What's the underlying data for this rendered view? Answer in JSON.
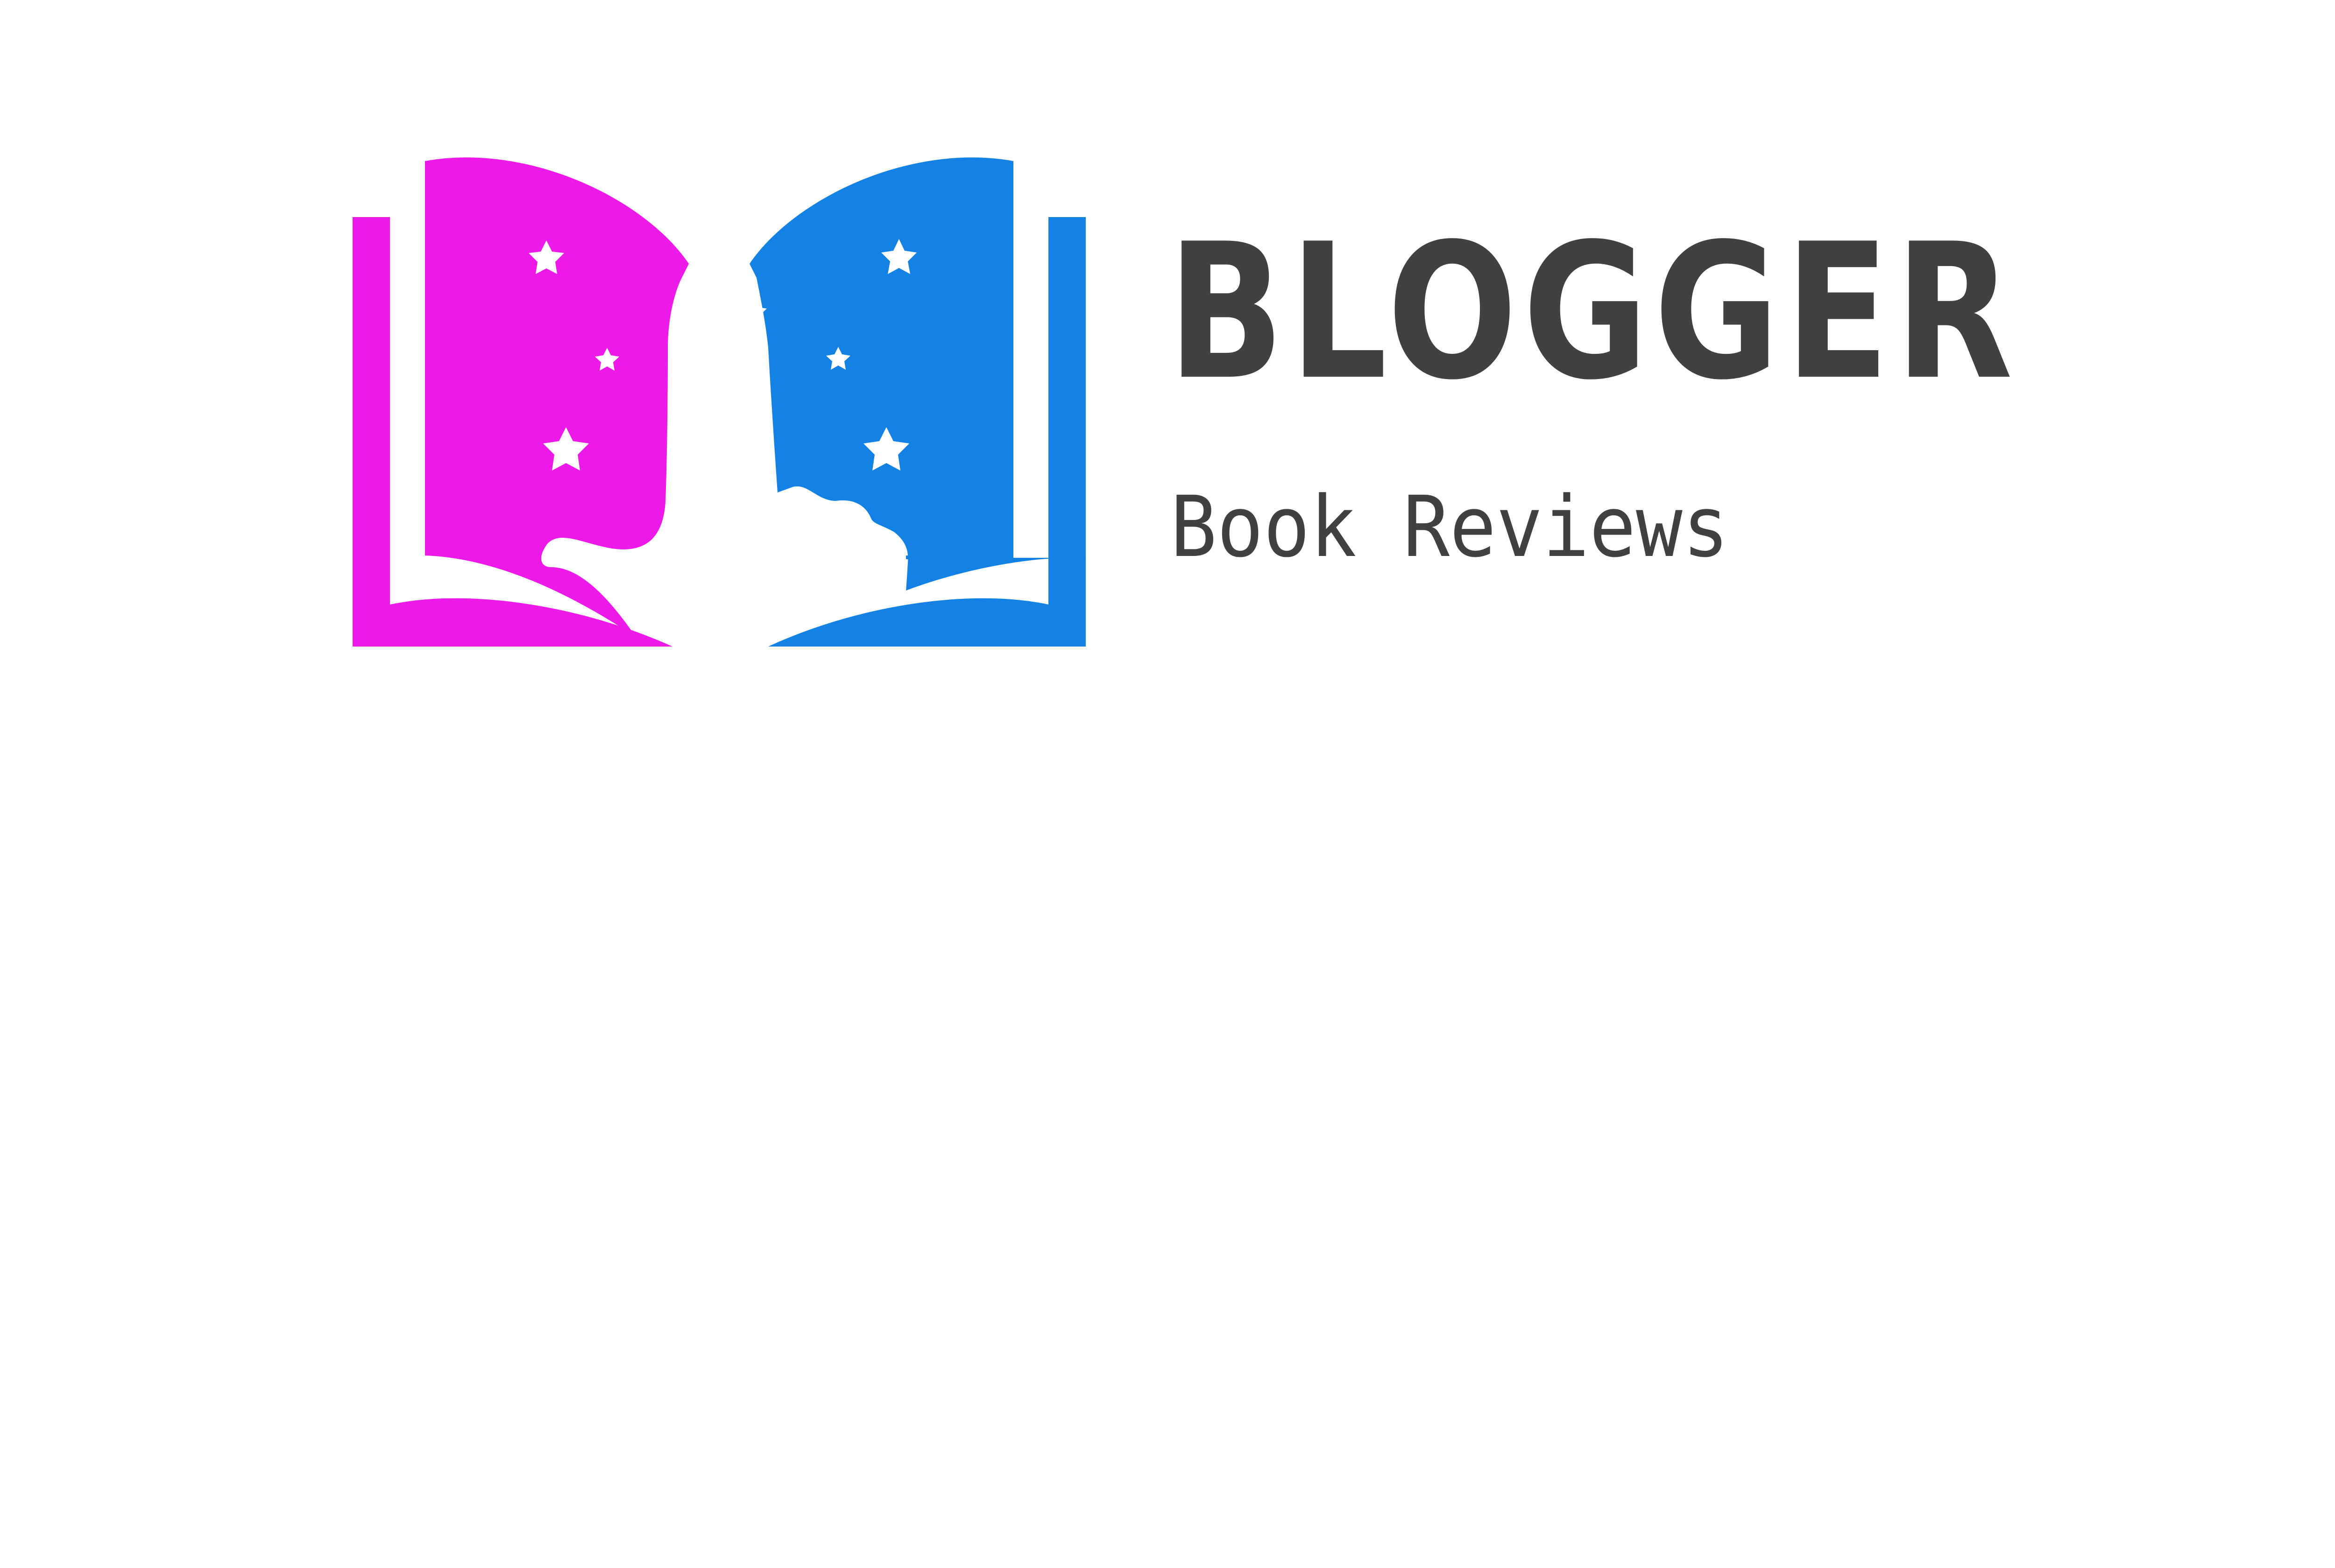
{
  "brand": {
    "name": "BLOGGER",
    "tagline": "Book Reviews",
    "icon": "open-book-with-stars-icon"
  },
  "colors": {
    "background": "#ffffff",
    "left_page": "#ec19e8",
    "right_page": "#1382e4",
    "stars": "#ffffff",
    "text": "#414141"
  }
}
